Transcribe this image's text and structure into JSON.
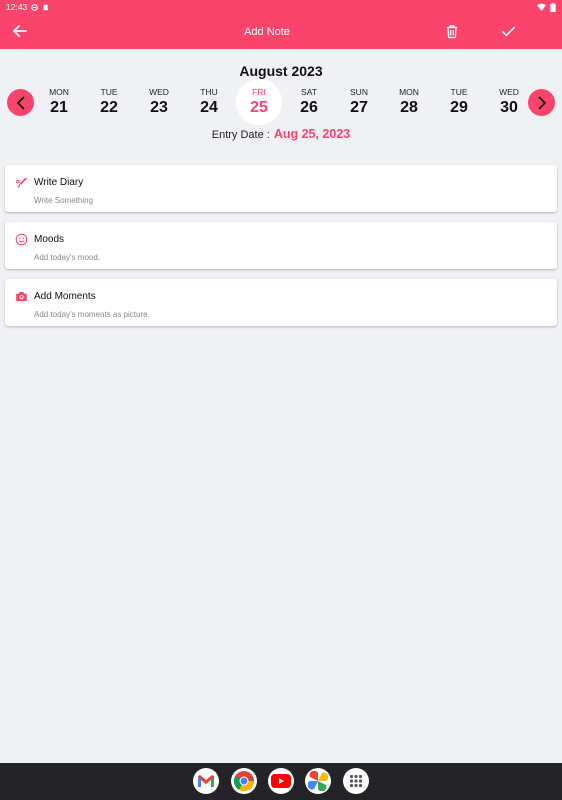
{
  "status": {
    "time": "12:43"
  },
  "header": {
    "title": "Add Note"
  },
  "calendar": {
    "month": "August 2023",
    "days": [
      {
        "dow": "MON",
        "num": "21"
      },
      {
        "dow": "TUE",
        "num": "22"
      },
      {
        "dow": "WED",
        "num": "23"
      },
      {
        "dow": "THU",
        "num": "24"
      },
      {
        "dow": "FRI",
        "num": "25"
      },
      {
        "dow": "SAT",
        "num": "26"
      },
      {
        "dow": "SUN",
        "num": "27"
      },
      {
        "dow": "MON",
        "num": "28"
      },
      {
        "dow": "TUE",
        "num": "29"
      },
      {
        "dow": "WED",
        "num": "30"
      }
    ],
    "selected_day": "25",
    "entry_label": "Entry Date :",
    "entry_value": "Aug 25, 2023"
  },
  "cards": [
    {
      "title": "Write Diary",
      "subtitle": "Write Something",
      "icon": "pen-nib-icon"
    },
    {
      "title": "Moods",
      "subtitle": "Add today's mood.",
      "icon": "smiley-icon"
    },
    {
      "title": "Add Moments",
      "subtitle": "Add today's moments as picture.",
      "icon": "camera-icon"
    }
  ],
  "dock": [
    "gmail-icon",
    "chrome-icon",
    "youtube-icon",
    "photos-icon",
    "app-drawer-icon"
  ],
  "colors": {
    "accent": "#fb446b",
    "background": "#f0f1f5",
    "navbar": "#242428"
  }
}
